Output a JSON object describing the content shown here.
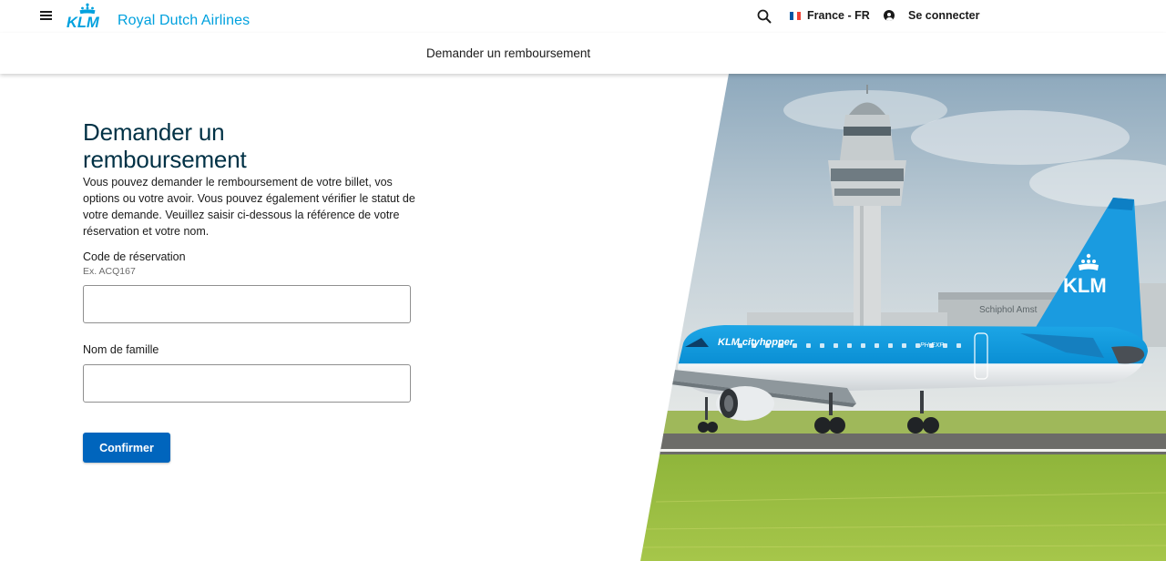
{
  "header": {
    "brand_wordmark": "KLM",
    "brand_name": "Royal Dutch Airlines",
    "locale": "France - FR",
    "login_label": "Se connecter",
    "subnav_title": "Demander un remboursement"
  },
  "form": {
    "title_line1": "Demander un",
    "title_line2": "remboursement",
    "intro": "Vous pouvez demander le remboursement de votre billet, vos options ou votre avoir. Vous pouvez également vérifier le statut de votre demande. Veuillez saisir ci-dessous la référence de votre réservation et votre nom.",
    "booking_code_label": "Code de réservation",
    "booking_code_hint": "Ex. ACQ167",
    "booking_code_value": "",
    "last_name_label": "Nom de famille",
    "last_name_value": "",
    "submit_label": "Confirmer"
  },
  "hero": {
    "tail_logo": "KLM",
    "fuselage_text": "KLM cityhopper",
    "registration": "PH-EXP",
    "building_sign": "Schiphol Amst"
  },
  "colors": {
    "brand_blue": "#00a1de",
    "title_navy": "#003145",
    "button_blue": "#0065bd"
  },
  "icons": {
    "menu": "hamburger-menu-icon",
    "search": "search-icon",
    "flag": "france-flag-icon",
    "user": "user-icon",
    "crown": "klm-crown-icon"
  }
}
